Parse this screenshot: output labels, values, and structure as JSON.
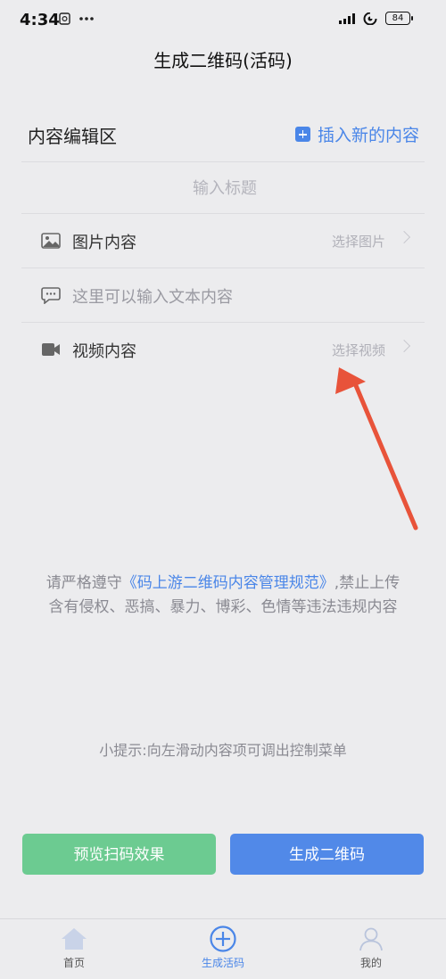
{
  "status": {
    "time": "4:34",
    "battery": "84"
  },
  "nav": {
    "title": "生成二维码(活码)"
  },
  "editor": {
    "section_title": "内容编辑区",
    "insert_label": "插入新的内容",
    "title_placeholder": "输入标题",
    "rows": [
      {
        "label": "图片内容",
        "action": "选择图片",
        "icon": "image-icon"
      },
      {
        "label": "这里可以输入文本内容",
        "action": "",
        "icon": "chat-icon"
      },
      {
        "label": "视频内容",
        "action": "选择视频",
        "icon": "video-icon"
      }
    ]
  },
  "notice": {
    "prefix": "请严格遵守",
    "link": "《码上游二维码内容管理规范》",
    "suffix": ",禁止上传含有侵权、恶搞、暴力、博彩、色情等违法违规内容"
  },
  "tip": "小提示:向左滑动内容项可调出控制菜单",
  "buttons": {
    "preview": "预览扫码效果",
    "generate": "生成二维码"
  },
  "tabs": [
    {
      "label": "首页",
      "icon": "home-icon"
    },
    {
      "label": "生成活码",
      "icon": "plus-circle-icon"
    },
    {
      "label": "我的",
      "icon": "user-icon"
    }
  ],
  "colors": {
    "accent": "#4a86e8",
    "green": "#6ccb91",
    "arrow": "#e8533a"
  }
}
